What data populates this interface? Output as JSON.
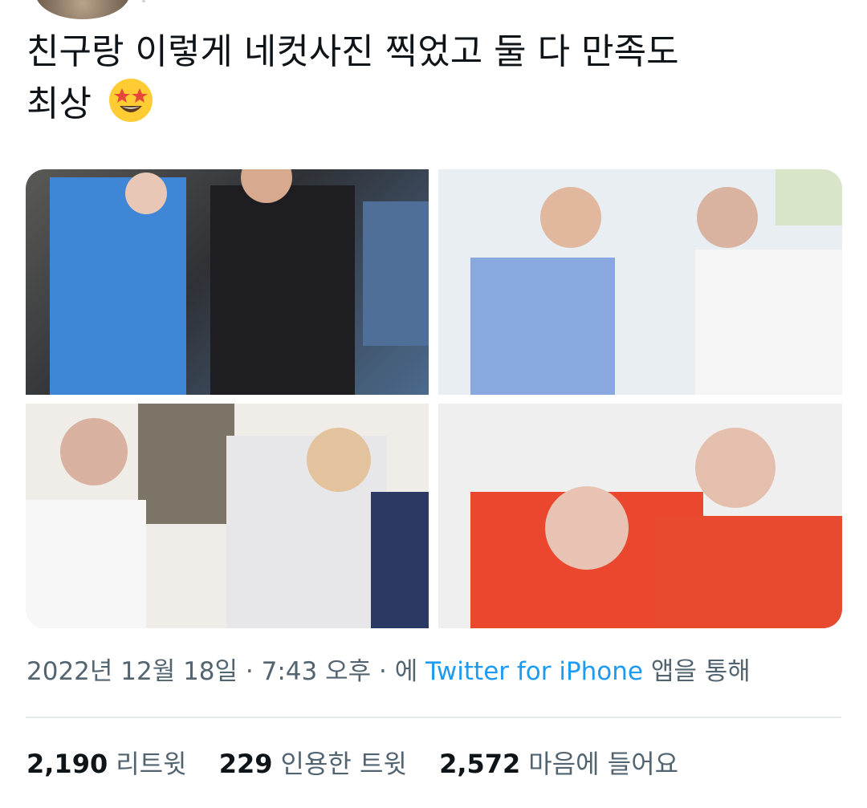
{
  "tweet": {
    "text_line1": "친구랑 이렇게 네컷사진 찍었고 둘 다 만족도",
    "text_line2": "최상",
    "emoji": "star-struck-emoji"
  },
  "photos": [
    {
      "label": "photo-1"
    },
    {
      "label": "photo-2"
    },
    {
      "label": "photo-3"
    },
    {
      "label": "photo-4"
    }
  ],
  "meta": {
    "date": "2022년 12월 18일",
    "sep1": "·",
    "time": "7:43 오후",
    "sep2": "·",
    "prefix": "에",
    "source": "Twitter for iPhone",
    "suffix": "앱을 통해"
  },
  "stats": {
    "retweets": "2,190",
    "retweets_label": "리트윗",
    "quotes": "229",
    "quotes_label": "인용한 트윗",
    "likes": "2,572",
    "likes_label": "마음에 들어요"
  },
  "colors": {
    "link": "#1d9bf0",
    "secondary_text": "#536471",
    "primary_text": "#0f1419",
    "divider": "#e7ebee"
  }
}
